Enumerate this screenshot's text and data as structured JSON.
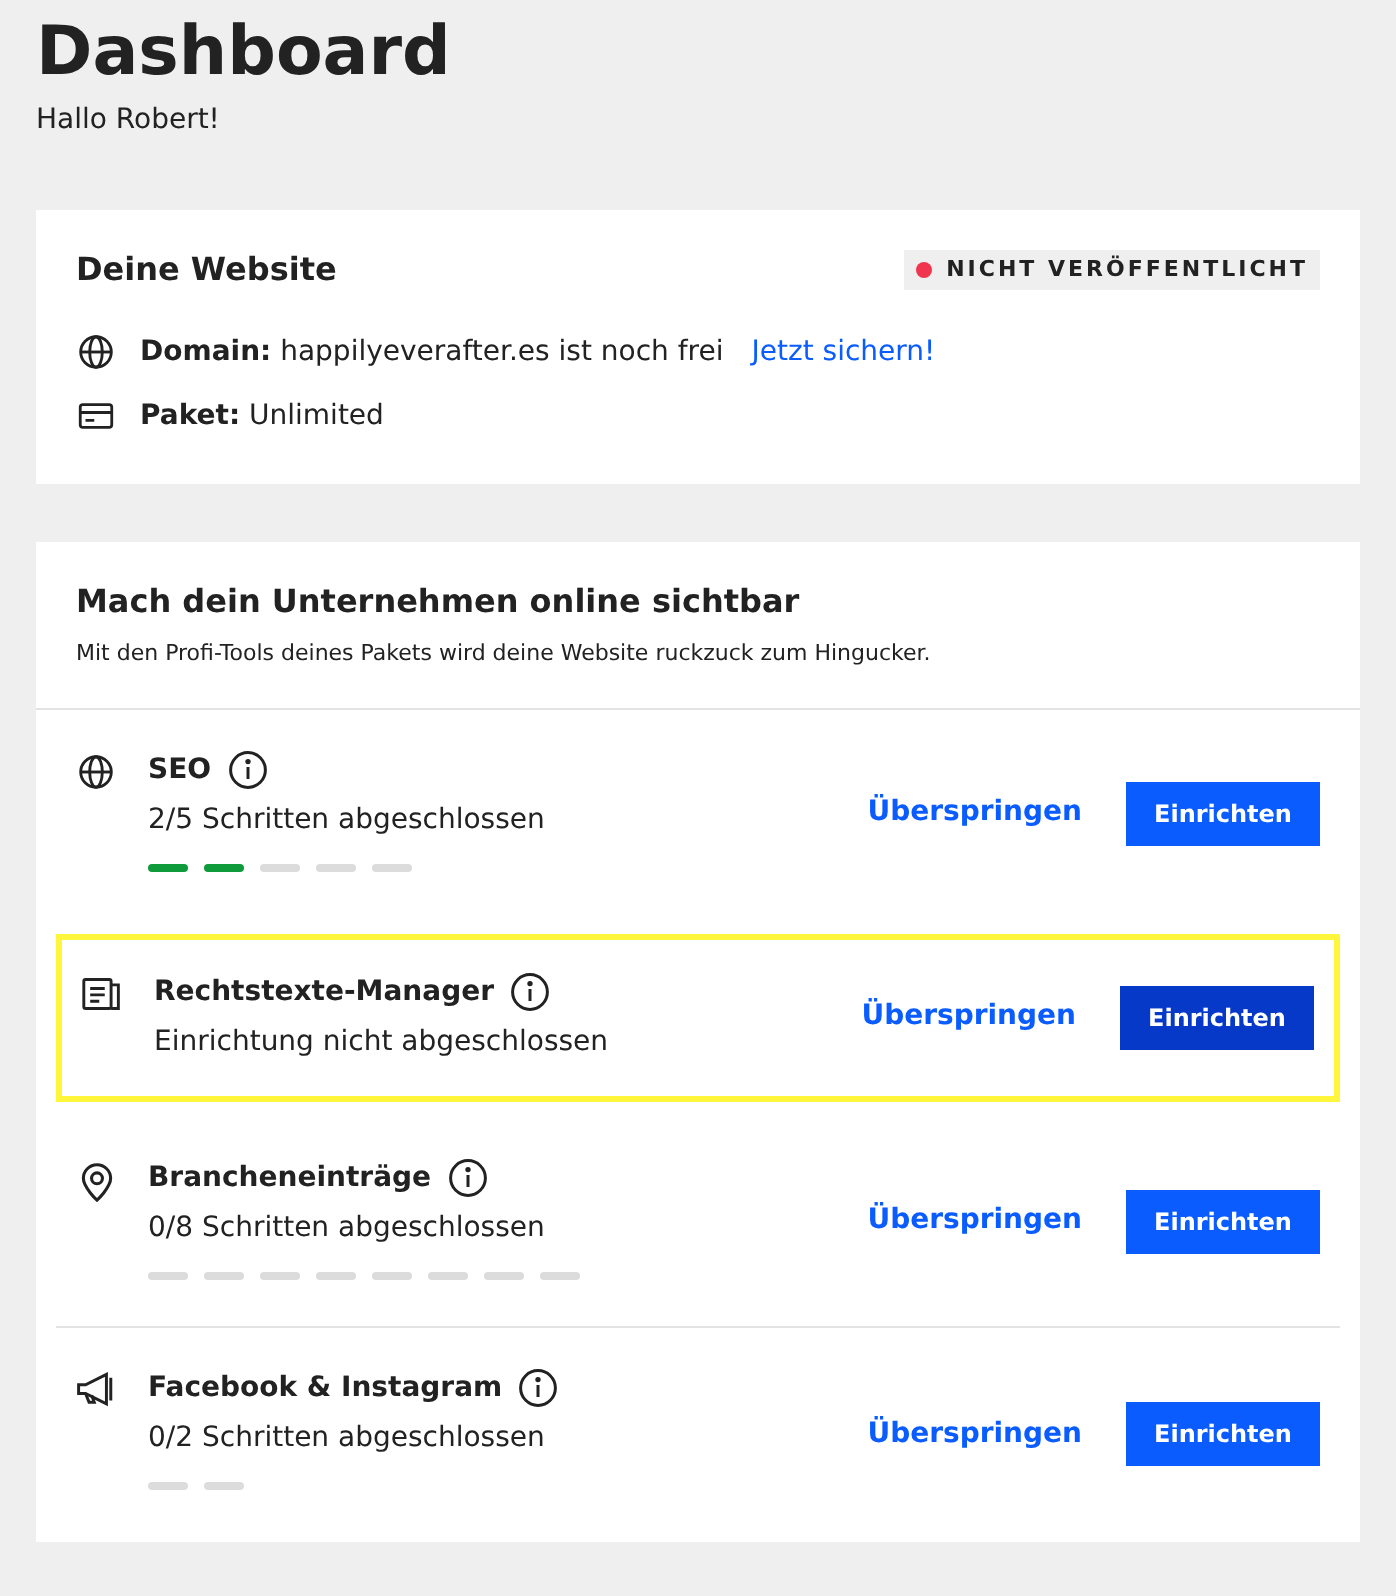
{
  "header": {
    "title": "Dashboard",
    "greeting": "Hallo Robert!"
  },
  "website_card": {
    "title": "Deine Website",
    "status": {
      "label": "NICHT VERÖFFENTLICHT",
      "color": "#f0364f"
    },
    "rows": [
      {
        "kind": "globe",
        "label": "Domain:",
        "value": "happilyeverafter.es ist noch frei",
        "link": "Jetzt sichern!"
      },
      {
        "kind": "card",
        "label": "Paket:",
        "value": "Unlimited"
      }
    ]
  },
  "tasks_card": {
    "title": "Mach dein Unternehmen online sichtbar",
    "subtitle": "Mit den Profi-Tools deines Pakets wird deine Website ruckzuck zum Hingucker.",
    "tasks": [
      {
        "kind": "globe",
        "title": "SEO",
        "subtitle": "2/5 Schritten abgeschlossen",
        "highlighted": false,
        "skip": "Überspringen",
        "action": "Einrichten",
        "steps": [
          {
            "done": true
          },
          {
            "done": true
          },
          {
            "done": false
          },
          {
            "done": false
          },
          {
            "done": false
          }
        ]
      },
      {
        "kind": "document",
        "title": "Rechtstexte-Manager",
        "subtitle": "Einrichtung nicht abgeschlossen",
        "highlighted": true,
        "skip": "Überspringen",
        "action": "Einrichten"
      },
      {
        "kind": "pin",
        "title": "Brancheneinträge",
        "subtitle": "0/8 Schritten abgeschlossen",
        "highlighted": false,
        "skip": "Überspringen",
        "action": "Einrichten",
        "steps": [
          {
            "done": false
          },
          {
            "done": false
          },
          {
            "done": false
          },
          {
            "done": false
          },
          {
            "done": false
          },
          {
            "done": false
          },
          {
            "done": false
          },
          {
            "done": false
          }
        ]
      },
      {
        "kind": "megaphone",
        "title": "Facebook & Instagram",
        "subtitle": "0/2 Schritten abgeschlossen",
        "highlighted": false,
        "skip": "Überspringen",
        "action": "Einrichten",
        "steps": [
          {
            "done": false
          },
          {
            "done": false
          }
        ]
      }
    ]
  }
}
